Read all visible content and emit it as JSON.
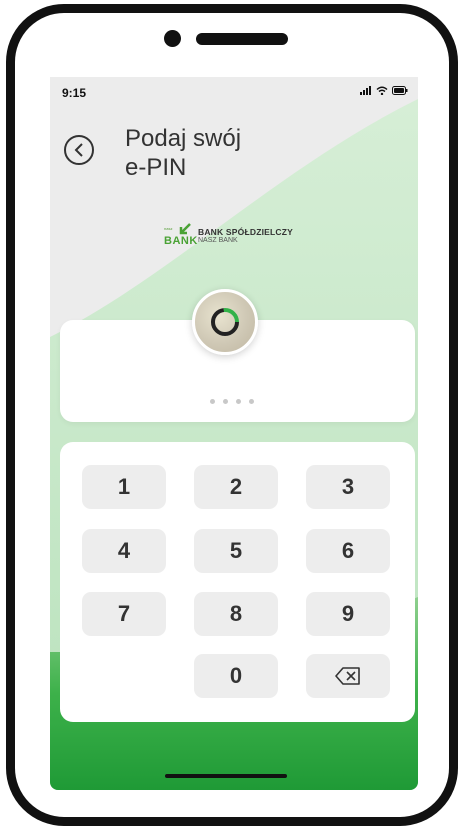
{
  "status_bar": {
    "time": "9:15",
    "icons": [
      "signal-icon",
      "wifi-icon",
      "battery-icon"
    ]
  },
  "header": {
    "title": "Podaj swój\ne-PIN",
    "back_icon": "chevron-left-icon"
  },
  "bank_logo": {
    "mark_small": "nasz",
    "mark_big": "BANK",
    "name": "BANK SPÓŁDZIELCZY",
    "subtitle": "NASZ BANK"
  },
  "pin": {
    "avatar_icon": "profile-avatar-icon",
    "loading_icon": "loading-spinner-icon",
    "digits_entered": 0,
    "digits_total": 4
  },
  "keypad": {
    "keys": [
      "1",
      "2",
      "3",
      "4",
      "5",
      "6",
      "7",
      "8",
      "9",
      "0"
    ],
    "delete_icon": "backspace-icon"
  },
  "colors": {
    "accent_green": "#2fa33b",
    "light_green": "#bfe4c1",
    "screen_bg": "#ececec",
    "key_bg": "#ededed"
  }
}
